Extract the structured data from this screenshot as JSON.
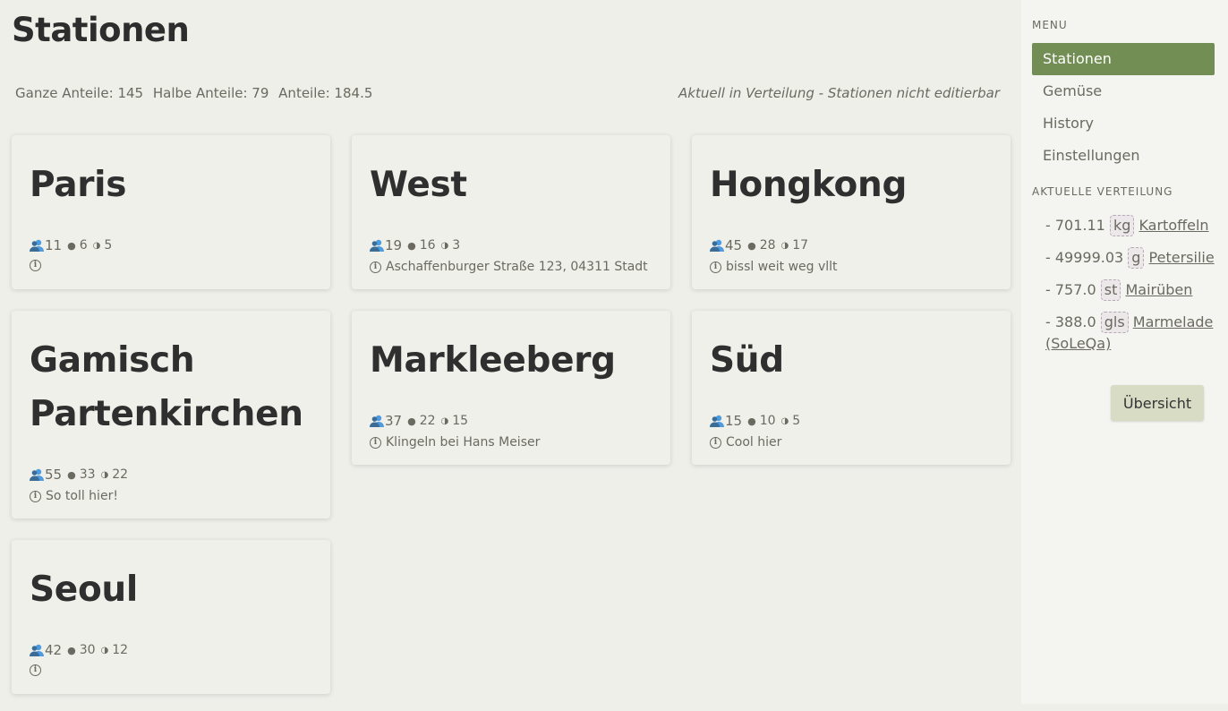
{
  "header": {
    "title": "Stationen",
    "summary": {
      "full": "Ganze Anteile: 145",
      "half": "Halbe Anteile: 79",
      "total": "Anteile: 184.5"
    },
    "notice": "Aktuell in Verteilung - Stationen nicht editierbar"
  },
  "stations": [
    {
      "name": "Paris",
      "total": "11",
      "full": "6",
      "half": "5",
      "info": ""
    },
    {
      "name": "West",
      "total": "19",
      "full": "16",
      "half": "3",
      "info": "Aschaffenburger Straße 123, 04311 Stadt"
    },
    {
      "name": "Hongkong",
      "total": "45",
      "full": "28",
      "half": "17",
      "info": "bissl weit weg vllt"
    },
    {
      "name": "Gamisch Partenkirchen",
      "total": "55",
      "full": "33",
      "half": "22",
      "info": "So toll hier!"
    },
    {
      "name": "Markleeberg",
      "total": "37",
      "full": "22",
      "half": "15",
      "info": "Klingeln bei Hans Meiser"
    },
    {
      "name": "Süd",
      "total": "15",
      "full": "10",
      "half": "5",
      "info": "Cool hier"
    },
    {
      "name": "Seoul",
      "total": "42",
      "full": "30",
      "half": "12",
      "info": ""
    }
  ],
  "sidebar": {
    "menu_label": "MENU",
    "items": [
      {
        "label": "Stationen",
        "active": true
      },
      {
        "label": "Gemüse"
      },
      {
        "label": "History"
      },
      {
        "label": "Einstellungen"
      }
    ],
    "distribution_label": "AKTUELLE VERTEILUNG",
    "distribution": [
      {
        "amount": "- 701.11",
        "unit": "kg",
        "name": "Kartoffeln"
      },
      {
        "amount": "- 49999.03",
        "unit": "g",
        "name": "Petersilie"
      },
      {
        "amount": "- 757.0",
        "unit": "st",
        "name": "Mairüben"
      },
      {
        "amount": "- 388.0",
        "unit": "gls",
        "name": "Marmelade (SoLeQa)"
      }
    ],
    "overview_button": "Übersicht"
  },
  "icons": {
    "people": "people-icon",
    "info": "info-icon"
  },
  "colors": {
    "accent": "#728e55",
    "background": "#efefea",
    "sidebar": "#f4f5f0",
    "button": "#d8dcc5"
  }
}
